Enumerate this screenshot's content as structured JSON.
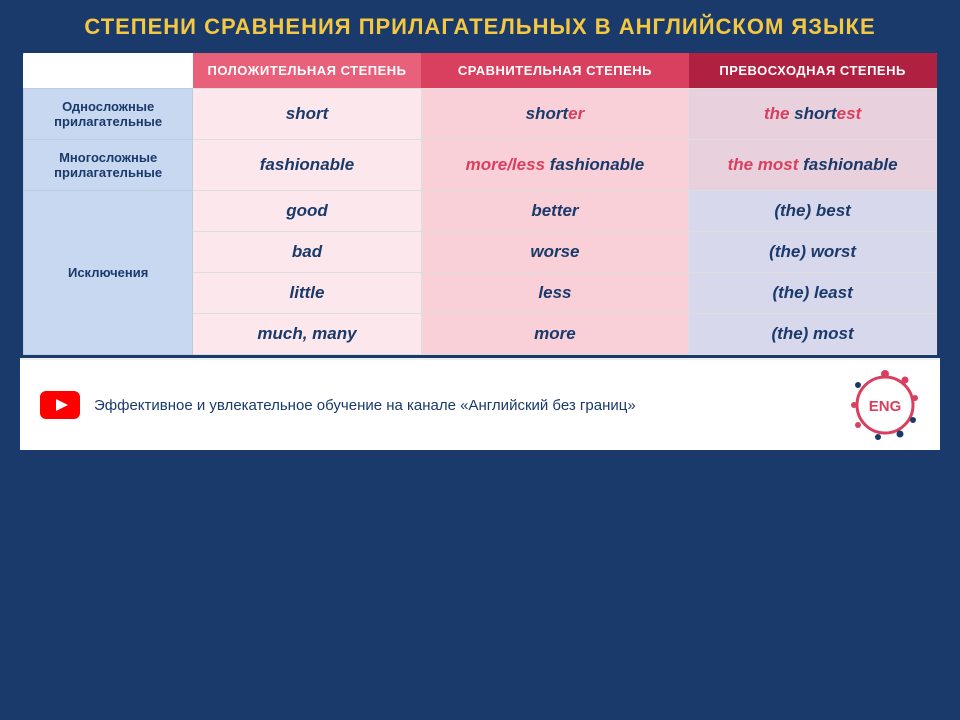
{
  "title": "СТЕПЕНИ СРАВНЕНИЯ ПРИЛАГАТЕЛЬНЫХ В АНГЛИЙСКОМ ЯЗЫКЕ",
  "headers": {
    "label_col": "",
    "positive": "ПОЛОЖИТЕЛЬНАЯ СТЕПЕНЬ",
    "comparative": "СРАВНИТЕЛЬНАЯ СТЕПЕНЬ",
    "superlative": "ПРЕВОСХОДНАЯ СТЕПЕНЬ"
  },
  "rows": [
    {
      "label": "Односложные прилагательные",
      "positive": "short",
      "comparative": "shorter",
      "superlative_prefix": "the ",
      "superlative_highlight": "short",
      "superlative_suffix": "est",
      "type": "short"
    },
    {
      "label": "Многосложные прилагательные",
      "positive": "fashionable",
      "comparative_prefix": "more/less ",
      "comparative_word": "fashionable",
      "superlative_prefix": "the most ",
      "superlative_word": "fashionable",
      "type": "long"
    }
  ],
  "exceptions": {
    "label": "Исключения",
    "rows": [
      {
        "positive": "good",
        "comparative": "better",
        "superlative": "(the) best"
      },
      {
        "positive": "bad",
        "comparative": "worse",
        "superlative": "(the) worst"
      },
      {
        "positive": "little",
        "comparative": "less",
        "superlative": "(the) least"
      },
      {
        "positive": "much, many",
        "comparative": "more",
        "superlative": "(the) most"
      }
    ]
  },
  "footer": {
    "text": "Эффективное и увлекательное обучение на канале «Английский без границ»",
    "logo": "ENG"
  }
}
